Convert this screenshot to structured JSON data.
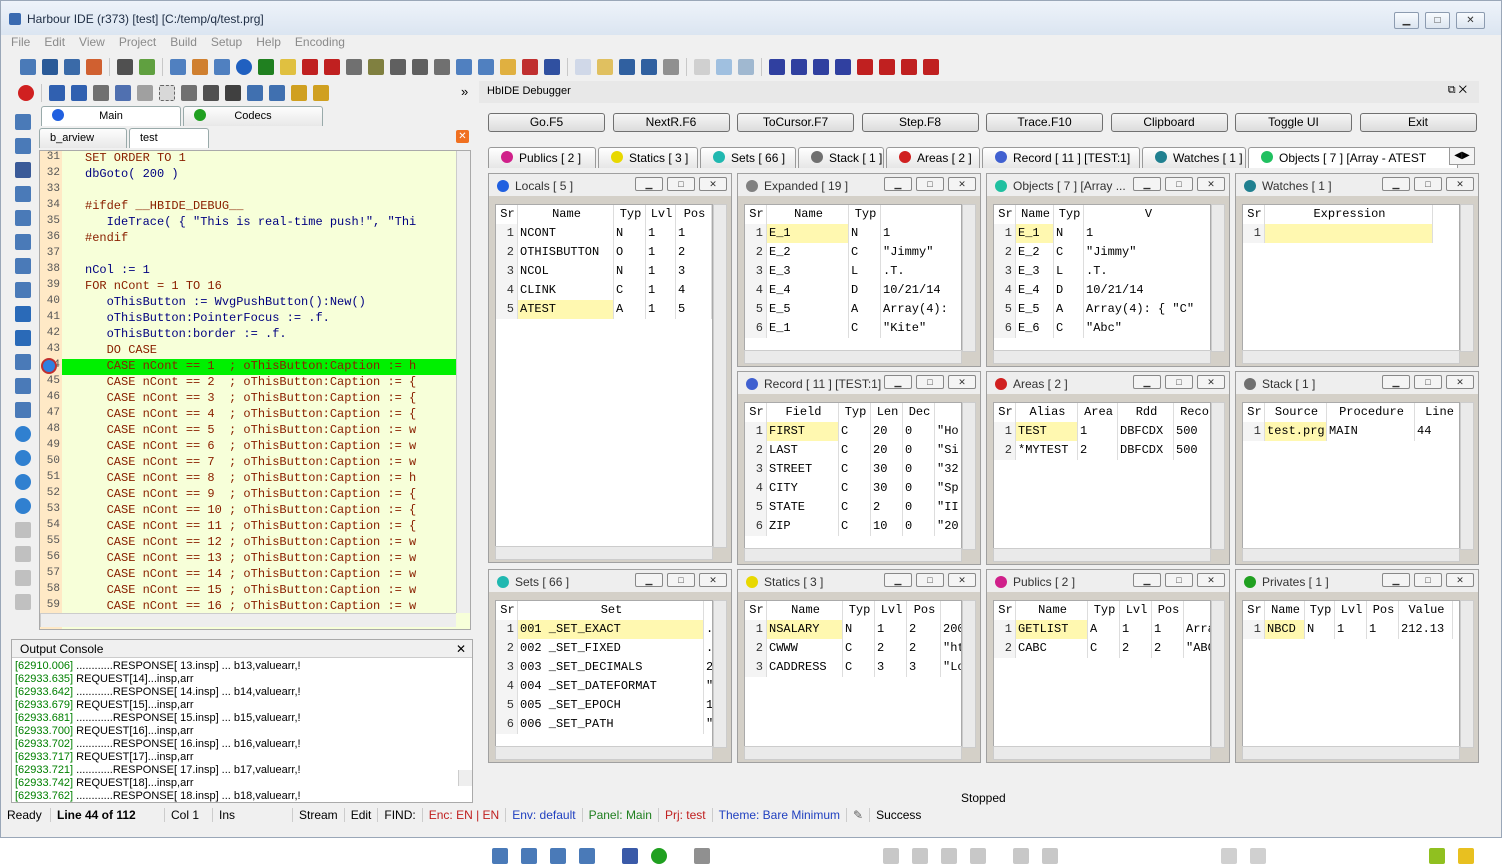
{
  "window": {
    "title": "Harbour IDE (r373) [test]  [C:/temp/q/test.prg]",
    "minimize": "▁",
    "maximize": "□",
    "close": "✕"
  },
  "menu": [
    "File",
    "Edit",
    "View",
    "Project",
    "Build",
    "Setup",
    "Help",
    "Encoding"
  ],
  "panels_tabs": {
    "main": "Main",
    "codecs": "Codecs"
  },
  "editor_tabs": [
    "b_arview",
    "test"
  ],
  "editor_lines": [
    {
      "n": "31",
      "t": "SET ORDER TO 1"
    },
    {
      "n": "32",
      "t": "dbGoto( 200 )"
    },
    {
      "n": "33",
      "t": ""
    },
    {
      "n": "34",
      "t": "#ifdef __HBIDE_DEBUG__"
    },
    {
      "n": "35",
      "t": "   IdeTrace( { \"This is real-time push!\", \"Thi"
    },
    {
      "n": "36",
      "t": "#endif"
    },
    {
      "n": "37",
      "t": ""
    },
    {
      "n": "38",
      "t": "nCol := 1"
    },
    {
      "n": "39",
      "t": "FOR nCont = 1 TO 16"
    },
    {
      "n": "40",
      "t": "   oThisButton := WvgPushButton():New()"
    },
    {
      "n": "41",
      "t": "   oThisButton:PointerFocus := .f."
    },
    {
      "n": "42",
      "t": "   oThisButton:border := .f."
    },
    {
      "n": "43",
      "t": "   DO CASE"
    },
    {
      "n": "44",
      "t": "   CASE nCont == 1  ; oThisButton:Caption := h"
    },
    {
      "n": "45",
      "t": "   CASE nCont == 2  ; oThisButton:Caption := {"
    },
    {
      "n": "46",
      "t": "   CASE nCont == 3  ; oThisButton:Caption := {"
    },
    {
      "n": "47",
      "t": "   CASE nCont == 4  ; oThisButton:Caption := {"
    },
    {
      "n": "48",
      "t": "   CASE nCont == 5  ; oThisButton:Caption := w"
    },
    {
      "n": "49",
      "t": "   CASE nCont == 6  ; oThisButton:Caption := w"
    },
    {
      "n": "50",
      "t": "   CASE nCont == 7  ; oThisButton:Caption := w"
    },
    {
      "n": "51",
      "t": "   CASE nCont == 8  ; oThisButton:Caption := h"
    },
    {
      "n": "52",
      "t": "   CASE nCont == 9  ; oThisButton:Caption := {"
    },
    {
      "n": "53",
      "t": "   CASE nCont == 10 ; oThisButton:Caption := {"
    },
    {
      "n": "54",
      "t": "   CASE nCont == 11 ; oThisButton:Caption := {"
    },
    {
      "n": "55",
      "t": "   CASE nCont == 12 ; oThisButton:Caption := w"
    },
    {
      "n": "56",
      "t": "   CASE nCont == 13 ; oThisButton:Caption := w"
    },
    {
      "n": "57",
      "t": "   CASE nCont == 14 ; oThisButton:Caption := w"
    },
    {
      "n": "58",
      "t": "   CASE nCont == 15 ; oThisButton:Caption := w"
    },
    {
      "n": "59",
      "t": "   CASE nCont == 16 ; oThisButton:Caption := w"
    }
  ],
  "output": {
    "title": "Output Console",
    "close": "✕",
    "lines": [
      {
        "ts": "[62910.006]",
        "t": " ............RESPONSE[ 13.insp] ... b13,valuearr,!"
      },
      {
        "ts": "[62933.635]",
        "t": " REQUEST[14]...insp,arr"
      },
      {
        "ts": "[62933.642]",
        "t": " ............RESPONSE[ 14.insp] ... b14,valuearr,!"
      },
      {
        "ts": "[62933.679]",
        "t": " REQUEST[15]...insp,arr"
      },
      {
        "ts": "[62933.681]",
        "t": " ............RESPONSE[ 15.insp] ... b15,valuearr,!"
      },
      {
        "ts": "[62933.700]",
        "t": " REQUEST[16]...insp,arr"
      },
      {
        "ts": "[62933.702]",
        "t": " ............RESPONSE[ 16.insp] ... b16,valuearr,!"
      },
      {
        "ts": "[62933.717]",
        "t": " REQUEST[17]...insp,arr"
      },
      {
        "ts": "[62933.721]",
        "t": " ............RESPONSE[ 17.insp] ... b17,valuearr,!"
      },
      {
        "ts": "[62933.742]",
        "t": " REQUEST[18]...insp,arr"
      },
      {
        "ts": "[62933.762]",
        "t": " ............RESPONSE[ 18.insp] ... b18,valuearr,!"
      }
    ]
  },
  "status": {
    "ready": "Ready",
    "line": "Line 44 of 112",
    "col": "Col 1",
    "ins": "Ins",
    "stream": "Stream",
    "edit": "Edit",
    "find": "FIND:",
    "enc": "Enc: EN | EN",
    "env": "Env: default",
    "panel": "Panel: Main",
    "prj": "Prj: test",
    "theme": "Theme: Bare Minimum",
    "success": "Success"
  },
  "debugger": {
    "title": "HbIDE Debugger",
    "buttons": [
      "Go.F5",
      "NextR.F6",
      "ToCursor.F7",
      "Step.F8",
      "Trace.F10",
      "Clipboard",
      "Toggle UI",
      "Exit"
    ],
    "tabs": [
      {
        "label": "Publics [ 2 ]",
        "color": "#d0208a"
      },
      {
        "label": "Statics [ 3 ]",
        "color": "#e8d800"
      },
      {
        "label": "Sets [ 66 ]",
        "color": "#20b8b0"
      },
      {
        "label": "Stack [ 1 ]",
        "color": "#707070"
      },
      {
        "label": "Areas [ 2 ]",
        "color": "#d02020"
      },
      {
        "label": "Record [ 11 ] [TEST:1]",
        "color": "#4060d0"
      },
      {
        "label": "Watches [ 1 ]",
        "color": "#208090"
      },
      {
        "label": "Objects [ 7 ] [Array - ATEST",
        "color": "#20c060"
      }
    ],
    "stopped": "Stopped"
  },
  "panels": [
    {
      "title": "Locals [ 5 ]",
      "color": "#2060e0",
      "cols": [
        {
          "h": "Sr",
          "w": 22
        },
        {
          "h": "Name",
          "w": 96
        },
        {
          "h": "Typ",
          "w": 32
        },
        {
          "h": "Lvl",
          "w": 30
        },
        {
          "h": "Pos",
          "w": 36
        }
      ],
      "rows": [
        [
          "1",
          "NCONT",
          "N",
          "1",
          "1"
        ],
        [
          "2",
          "OTHISBUTTON",
          "O",
          "1",
          "2"
        ],
        [
          "3",
          "NCOL",
          "N",
          "1",
          "3"
        ],
        [
          "4",
          "CLINK",
          "C",
          "1",
          "4"
        ],
        [
          "5",
          "ATEST",
          "A",
          "1",
          "5"
        ]
      ],
      "hl": 4
    },
    {
      "title": "Expanded [ 19 ]",
      "color": "#808080",
      "cols": [
        {
          "h": "Sr",
          "w": 22
        },
        {
          "h": "Name",
          "w": 82
        },
        {
          "h": "Typ",
          "w": 32
        },
        {
          "h": "",
          "w": 82
        }
      ],
      "rows": [
        [
          "1",
          "E_1",
          "N",
          "1"
        ],
        [
          "2",
          "E_2",
          "C",
          "\"Jimmy\""
        ],
        [
          "3",
          "E_3",
          "L",
          ".T."
        ],
        [
          "4",
          "E_4",
          "D",
          "10/21/14"
        ],
        [
          "5",
          "E_5",
          "A",
          "Array(4):"
        ],
        [
          "6",
          "  E_1",
          "C",
          "\"Kite\""
        ]
      ],
      "hl": 0
    },
    {
      "title": "Objects [ 7 ] [Array ...",
      "color": "#20c0a0",
      "cols": [
        {
          "h": "Sr",
          "w": 22
        },
        {
          "h": "Name",
          "w": 38
        },
        {
          "h": "Typ",
          "w": 30
        },
        {
          "h": "V",
          "w": 128
        }
      ],
      "rows": [
        [
          "1",
          "E_1",
          "N",
          "1"
        ],
        [
          "2",
          "E_2",
          "C",
          "\"Jimmy\""
        ],
        [
          "3",
          "E_3",
          "L",
          ".T."
        ],
        [
          "4",
          "E_4",
          "D",
          "10/21/14"
        ],
        [
          "5",
          "E_5",
          "A",
          "Array(4): { \"C\""
        ],
        [
          "6",
          "E_6",
          "C",
          "\"Abc\""
        ]
      ],
      "hl": 0
    },
    {
      "title": "Watches [ 1 ]",
      "color": "#208090",
      "cols": [
        {
          "h": "Sr",
          "w": 22
        },
        {
          "h": "Expression",
          "w": 168
        }
      ],
      "rows": [
        [
          "1",
          ""
        ]
      ],
      "hl": 0
    },
    {
      "title": "Record [ 11 ] [TEST:1]",
      "color": "#4060d0",
      "cols": [
        {
          "h": "Sr",
          "w": 22
        },
        {
          "h": "Field",
          "w": 72
        },
        {
          "h": "Typ",
          "w": 32
        },
        {
          "h": "Len",
          "w": 32
        },
        {
          "h": "Dec",
          "w": 32
        },
        {
          "h": "",
          "w": 30
        }
      ],
      "rows": [
        [
          "1",
          "FIRST",
          "C",
          "20",
          "0",
          "\"Ho"
        ],
        [
          "2",
          "LAST",
          "C",
          "20",
          "0",
          "\"Si"
        ],
        [
          "3",
          "STREET",
          "C",
          "30",
          "0",
          "\"32"
        ],
        [
          "4",
          "CITY",
          "C",
          "30",
          "0",
          "\"Sp"
        ],
        [
          "5",
          "STATE",
          "C",
          "2",
          "0",
          "\"II"
        ],
        [
          "6",
          "ZIP",
          "C",
          "10",
          "0",
          "\"20"
        ]
      ],
      "hl": 0
    },
    {
      "title": "Areas [ 2 ]",
      "color": "#d02020",
      "cols": [
        {
          "h": "Sr",
          "w": 22
        },
        {
          "h": "Alias",
          "w": 62
        },
        {
          "h": "Area",
          "w": 40
        },
        {
          "h": "Rdd",
          "w": 56
        },
        {
          "h": "Reco",
          "w": 40
        }
      ],
      "rows": [
        [
          "1",
          "TEST",
          "1",
          "DBFCDX",
          "500"
        ],
        [
          "2",
          "*MYTEST",
          "2",
          "DBFCDX",
          "500"
        ]
      ],
      "hl": 0
    },
    {
      "title": "Stack [ 1 ]",
      "color": "#707070",
      "cols": [
        {
          "h": "Sr",
          "w": 22
        },
        {
          "h": "Source",
          "w": 62
        },
        {
          "h": "Procedure",
          "w": 88
        },
        {
          "h": "Line",
          "w": 48
        }
      ],
      "rows": [
        [
          "1",
          "test.prg",
          "MAIN",
          "44"
        ]
      ],
      "hl": 0
    },
    {
      "title": "Sets [ 66 ]",
      "color": "#20b8b0",
      "cols": [
        {
          "h": "Sr",
          "w": 22
        },
        {
          "h": "Set",
          "w": 186
        },
        {
          "h": "",
          "w": 10
        }
      ],
      "rows": [
        [
          "1",
          "001  _SET_EXACT",
          "."
        ],
        [
          "2",
          "002  _SET_FIXED",
          "."
        ],
        [
          "3",
          "003  _SET_DECIMALS",
          "2"
        ],
        [
          "4",
          "004  _SET_DATEFORMAT",
          "\""
        ],
        [
          "5",
          "005  _SET_EPOCH",
          "1"
        ],
        [
          "6",
          "006  _SET_PATH",
          "\""
        ]
      ],
      "hl": 0
    },
    {
      "title": "Statics [ 3 ]",
      "color": "#e8d800",
      "cols": [
        {
          "h": "Sr",
          "w": 22
        },
        {
          "h": "Name",
          "w": 76
        },
        {
          "h": "Typ",
          "w": 32
        },
        {
          "h": "Lvl",
          "w": 32
        },
        {
          "h": "Pos",
          "w": 34
        },
        {
          "h": "",
          "w": 30
        }
      ],
      "rows": [
        [
          "1",
          "NSALARY",
          "N",
          "1",
          "2",
          "200"
        ],
        [
          "2",
          "CWWW",
          "C",
          "2",
          "2",
          "\"ht"
        ],
        [
          "3",
          "CADDRESS",
          "C",
          "3",
          "3",
          "\"Lo"
        ]
      ],
      "hl": 0
    },
    {
      "title": "Publics [ 2 ]",
      "color": "#d0208a",
      "cols": [
        {
          "h": "Sr",
          "w": 22
        },
        {
          "h": "Name",
          "w": 72
        },
        {
          "h": "Typ",
          "w": 32
        },
        {
          "h": "Lvl",
          "w": 32
        },
        {
          "h": "Pos",
          "w": 32
        },
        {
          "h": "",
          "w": 40
        }
      ],
      "rows": [
        [
          "1",
          "GETLIST",
          "A",
          "1",
          "1",
          "Arra"
        ],
        [
          "2",
          "CABC",
          "C",
          "2",
          "2",
          "\"ABC"
        ]
      ],
      "hl": 0
    },
    {
      "title": "Privates [ 1 ]",
      "color": "#20a020",
      "cols": [
        {
          "h": "Sr",
          "w": 22
        },
        {
          "h": "Name",
          "w": 40
        },
        {
          "h": "Typ",
          "w": 30
        },
        {
          "h": "Lvl",
          "w": 32
        },
        {
          "h": "Pos",
          "w": 32
        },
        {
          "h": "Value",
          "w": 54
        }
      ],
      "rows": [
        [
          "1",
          "NBCD",
          "N",
          "1",
          "1",
          "212.13"
        ]
      ],
      "hl": 0
    }
  ]
}
